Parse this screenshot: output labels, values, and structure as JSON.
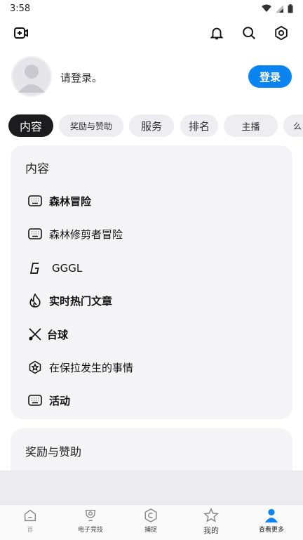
{
  "status_bar": {
    "time": "3:58"
  },
  "profile": {
    "prompt": "请登录。",
    "login_label": "登录"
  },
  "chips": [
    "内容",
    "奖励与赞助",
    "服务",
    "排名",
    "主播",
    "么"
  ],
  "content_card": {
    "title": "内容",
    "items": [
      {
        "label": "森林冒险",
        "icon": "keyboard-icon"
      },
      {
        "label": "森林修剪者冒险",
        "icon": "keyboard-icon"
      },
      {
        "label": "GGGL",
        "icon": "gggl-logo-icon"
      },
      {
        "label": "实时热门文章",
        "icon": "flame-icon"
      },
      {
        "label": "台球",
        "icon": "cue-sticks-icon"
      },
      {
        "label": "在保拉发生的事情",
        "icon": "star-badge-icon"
      },
      {
        "label": "活动",
        "icon": "keyboard-icon"
      }
    ]
  },
  "rewards_card": {
    "title": "奖励与赞助"
  },
  "bottom_nav": [
    {
      "label": "首",
      "icon": "home-icon"
    },
    {
      "label": "电子竞技",
      "icon": "esports-icon"
    },
    {
      "label": "捕捉",
      "icon": "capture-icon"
    },
    {
      "label": "我的",
      "icon": "star-icon"
    },
    {
      "label": "查看更多",
      "icon": "person-icon"
    }
  ],
  "colors": {
    "accent": "#0a84f0",
    "active_chip": "#1c1c1e",
    "card_bg": "#f4f4f6"
  }
}
